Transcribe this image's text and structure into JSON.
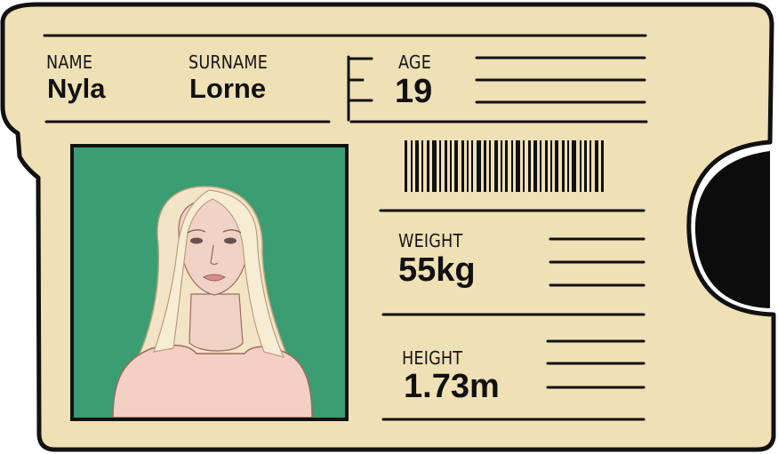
{
  "card": {
    "colors": {
      "background": "#efe0b5",
      "ink": "#111111",
      "photo_bg": "#3a9e72",
      "skin": "#f1d2c6",
      "hair": "#f4e4c6",
      "top": "#f4cfc4"
    },
    "name": {
      "label": "NAME",
      "value": "Nyla"
    },
    "surname": {
      "label": "SURNAME",
      "value": "Lorne"
    },
    "age": {
      "label": "AGE",
      "value": "19"
    },
    "weight": {
      "label": "WEIGHT",
      "value": "55kg"
    },
    "height": {
      "label": "HEIGHT",
      "value": "1.73m"
    },
    "photo": {
      "icon": "portrait-photo"
    },
    "barcode": {
      "icon": "barcode-icon"
    }
  }
}
